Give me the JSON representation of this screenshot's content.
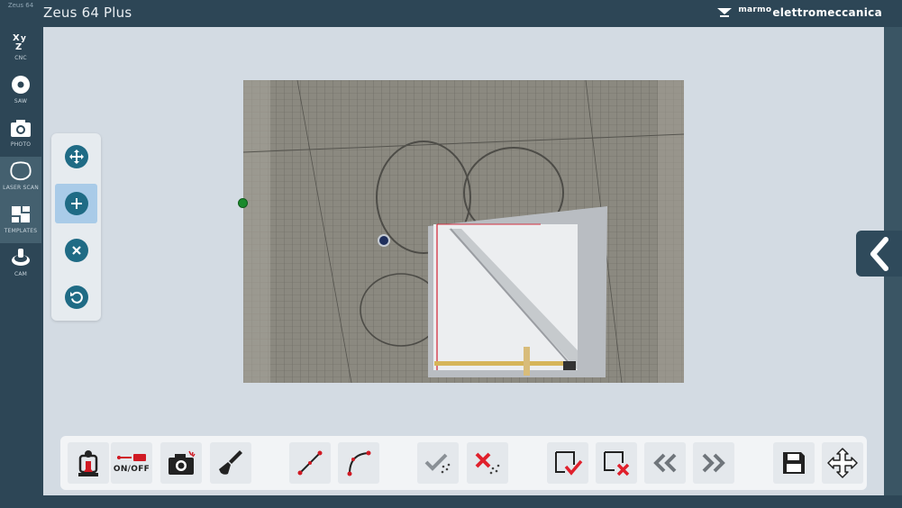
{
  "app": {
    "title": "Zeus 64 Plus",
    "brand_prefix": "marmo",
    "brand_suffix": "elettromeccanica",
    "logo_text": "Zeus 64"
  },
  "sidebar": {
    "items": [
      {
        "label": "CNC",
        "icon": "xyz-icon",
        "active": false
      },
      {
        "label": "SAW",
        "icon": "saw-blade-icon",
        "active": false
      },
      {
        "label": "PHOTO",
        "icon": "camera-icon",
        "active": false
      },
      {
        "label": "LASER SCAN",
        "icon": "laser-scan-icon",
        "active": true
      },
      {
        "label": "TEMPLATES",
        "icon": "templates-icon",
        "active": true
      },
      {
        "label": "CAM",
        "icon": "cam-icon",
        "active": false
      }
    ]
  },
  "tool_panel": {
    "buttons": [
      {
        "icon": "move-arrows-icon",
        "selected": false
      },
      {
        "icon": "plus-icon",
        "selected": true
      },
      {
        "icon": "close-icon",
        "selected": false
      },
      {
        "icon": "undo-icon",
        "selected": false
      }
    ]
  },
  "toolbar": {
    "onoff_label": "ON/OFF",
    "buttons": [
      "machine-head-icon",
      "laser-toggle-icon",
      "camera-capture-icon",
      "brush-icon",
      "line-tool-icon",
      "arc-tool-icon",
      "confirm-points-icon",
      "delete-points-icon",
      "confirm-shape-icon",
      "delete-shape-icon",
      "previous-icon",
      "next-icon",
      "save-icon",
      "pan-icon"
    ]
  },
  "colors": {
    "frame": "#2d4656",
    "workspace": "#d3dbe3",
    "accent": "#1f6b85",
    "selected": "#a9cbe8",
    "danger": "#e0202c",
    "point_green": "#1a8a2c",
    "point_navy": "#1f2f5c"
  }
}
